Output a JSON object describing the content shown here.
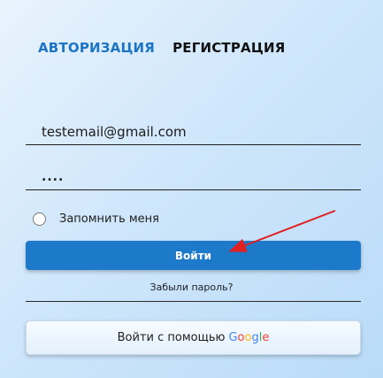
{
  "tabs": [
    {
      "label": "АВТОРИЗАЦИЯ",
      "active": true
    },
    {
      "label": "РЕГИСТРАЦИЯ",
      "active": false
    }
  ],
  "form": {
    "email_value": "testemail@gmail.com",
    "password_value": "....",
    "remember_label": "Запомнить меня",
    "remember_checked": false,
    "login_label": "Войти",
    "forgot_label": "Забыли пароль?"
  },
  "google": {
    "prefix_label": "Войти с помощью",
    "brand_letters": [
      "G",
      "o",
      "o",
      "g",
      "l",
      "e"
    ]
  },
  "colors": {
    "accent": "#1d7acb",
    "active_tab": "#1b74c4",
    "annotation_arrow": "#e02020",
    "background": "#cfe6fb"
  }
}
